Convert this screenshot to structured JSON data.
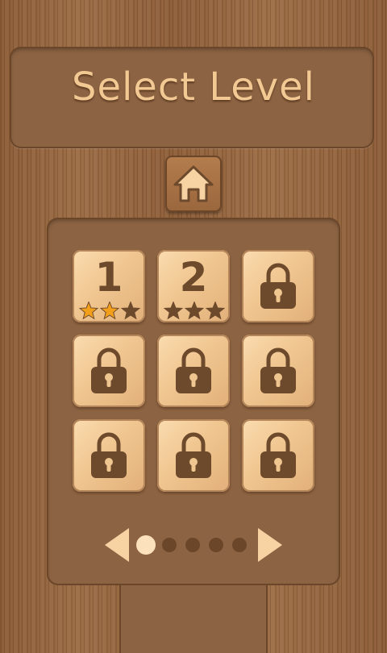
{
  "header": {
    "title": "Select Level"
  },
  "home_button": {
    "icon": "home-icon"
  },
  "levels": [
    {
      "label": "1",
      "locked": false,
      "stars_earned": 2,
      "stars_total": 3
    },
    {
      "label": "2",
      "locked": false,
      "stars_earned": 0,
      "stars_total": 3
    },
    {
      "label": "",
      "locked": true
    },
    {
      "label": "",
      "locked": true
    },
    {
      "label": "",
      "locked": true
    },
    {
      "label": "",
      "locked": true
    },
    {
      "label": "",
      "locked": true
    },
    {
      "label": "",
      "locked": true
    },
    {
      "label": "",
      "locked": true
    }
  ],
  "pager": {
    "current_page": 1,
    "total_pages": 5
  },
  "colors": {
    "star_earned": "#f2a01c",
    "star_empty": "#6e4a2c",
    "icon": "#6e4a2c",
    "title": "#f2c893",
    "dot_active": "#fbe2bd",
    "dot_inactive": "#6b4629"
  }
}
